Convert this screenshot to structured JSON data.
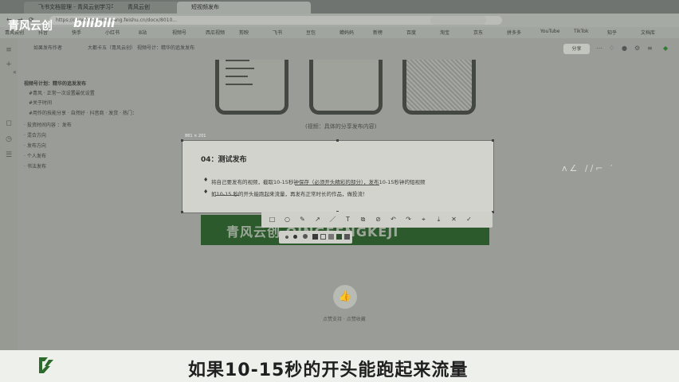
{
  "browser": {
    "tabs": [
      "飞书文档管理 - 青风云创学习平台",
      "青风云创",
      "短视频发布"
    ],
    "url": "https://q1ngfengyunchuang.feishu.cn/docx/8010..."
  },
  "bookmarks": [
    "青风云创",
    "抖音",
    "快手",
    "小红书",
    "B站",
    "视频号",
    "西瓜视频",
    "剪映",
    "飞书",
    "豆包",
    "蝉妈妈",
    "新榜",
    "百度",
    "淘宝",
    "京东",
    "拼多多",
    "YouTube",
    "TikTok",
    "知乎",
    "文档库"
  ],
  "doc": {
    "breadcrumb": [
      "如果发布作者",
      "大都卡五（青风云创）",
      "视频号计：精华的追发发布"
    ],
    "share_label": "分享",
    "outline": [
      "视频号计划：精华的追发发布",
      "#青风 · 正常一次设置最优设置",
      "#关于时间",
      "#用作的技能分享 · 自然好 · 抖音商 · 发货 · 热门：",
      "· 投资时间内容 ：发布",
      "· 混合方向",
      "· 发布方向",
      "· 个人发布",
      "· 书法发布"
    ]
  },
  "caption": "(视频：具体的分享发布内容)",
  "card": {
    "title": "04：测试发布",
    "line1": "将自己要发布的视频，截取10-15秒钟保存（必须开头精彩的部分），发布10-15秒钟的短视频",
    "line2": "如10-15 秒的开头能跑起来流量，再发布正常时长的作品，做投流！",
    "size_badge": "881 × 201"
  },
  "banner_text": "青风云创 QINGFENGKEJI",
  "like_caption": "点赞支持 · 点赞收藏",
  "watermark": {
    "brand": "青风云创",
    "site": "bilibili"
  },
  "subtitle": "如果10-15秒的开头能跑起来流量",
  "icons": {
    "toolbar": [
      "rect-icon",
      "circle-icon",
      "pen-icon",
      "arrow-icon",
      "line-icon",
      "text-icon",
      "copy-icon",
      "link-icon",
      "undo-icon",
      "redo-icon",
      "pin-icon",
      "save-icon",
      "close-icon",
      "check-icon"
    ]
  },
  "colors": {
    "banner": "#2c5a2c",
    "subtitle_bg": "#eef0ec",
    "card_bg": "#d2d3cd"
  }
}
